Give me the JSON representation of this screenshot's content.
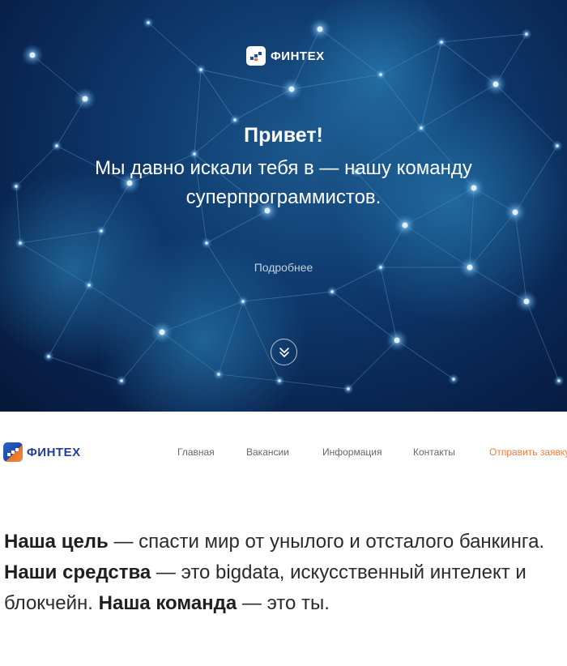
{
  "hero": {
    "logo_text": "ФИНТЕХ",
    "title": "Привет!",
    "subtitle": "Мы давно искали тебя в — нашу команду суперпрограммистов.",
    "more_link": "Подробнее",
    "scroll_icon": "double-chevron-down-icon"
  },
  "nav": {
    "logo_text": "ФИНТЕХ",
    "links": [
      {
        "label": "Главная"
      },
      {
        "label": "Вакансии"
      },
      {
        "label": "Информация"
      },
      {
        "label": "Контакты"
      }
    ],
    "cta": {
      "label": "Отправить заявку",
      "color": "#ee7c3c"
    }
  },
  "content": {
    "goal_label": "Наша цель",
    "goal_text": " — спасти мир от унылого и отсталого банкинга.",
    "means_label": "Наши средства",
    "means_text": " — это bigdata, искусственный интелект и блокчейн. ",
    "team_label": "Наша команда",
    "team_text": " — это ты."
  },
  "colors": {
    "hero_bg": "#0f3c70",
    "brand_blue": "#1d3f9a",
    "accent_orange": "#ee7c3c"
  }
}
